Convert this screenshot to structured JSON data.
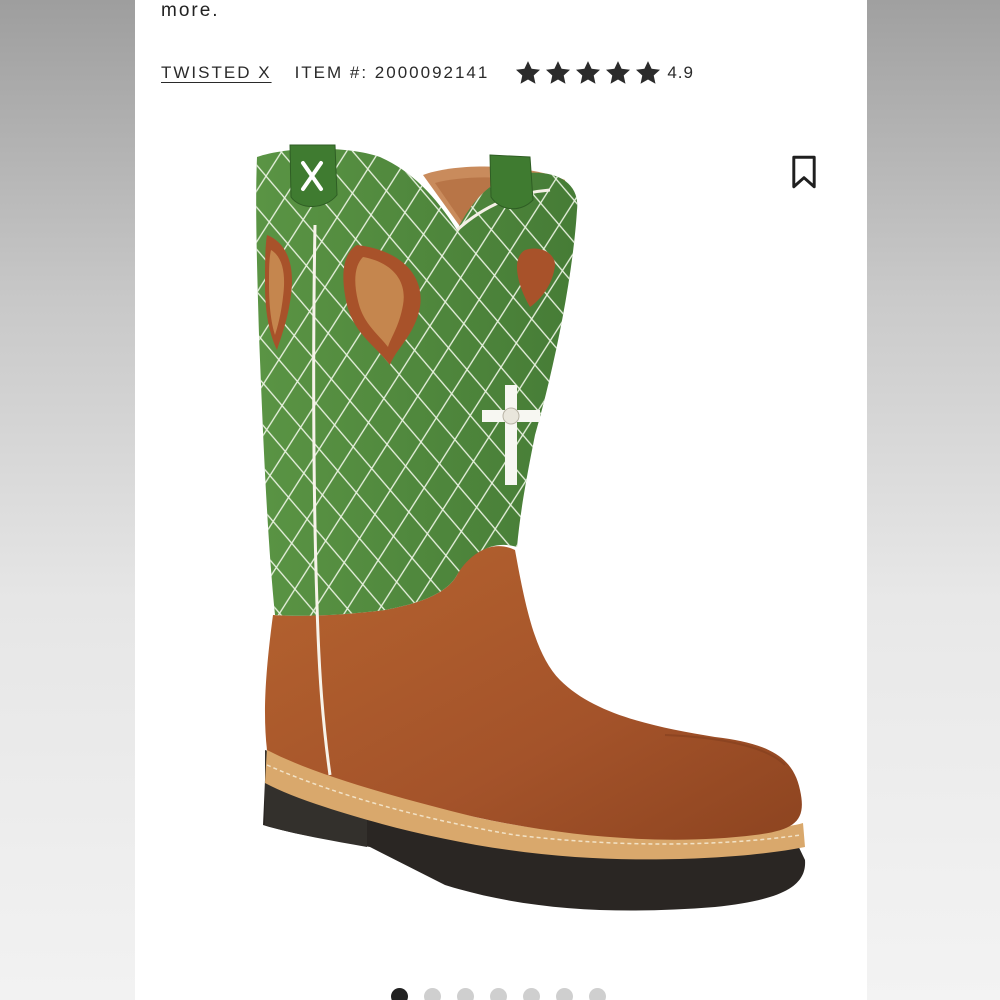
{
  "header": {
    "more_text": "more.",
    "brand_link": "TWISTED X",
    "item_number": "ITEM #: 2000092141",
    "rating_value": "4.9",
    "rating_stars": 5
  },
  "gallery": {
    "total_images": 7,
    "active_index": 0
  },
  "icons": {
    "bookmark": "bookmark-icon",
    "star": "star-icon"
  },
  "colors": {
    "boot_green": "#4f8a3c",
    "boot_brown": "#a6562b",
    "sole_dark": "#2a2623",
    "welt_tan": "#d9a86c",
    "dot_active": "#222222",
    "dot_inactive": "#cfcfcf"
  }
}
